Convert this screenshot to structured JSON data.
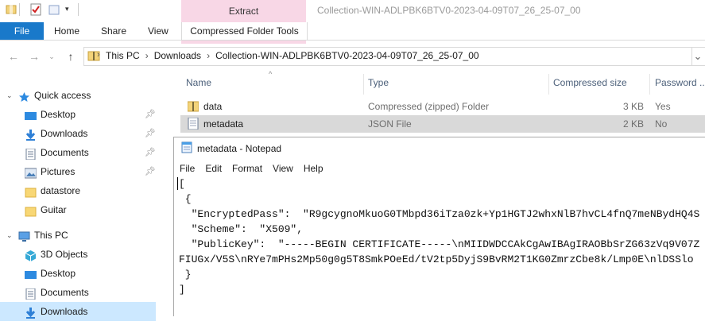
{
  "title_bar": {
    "window_title": "Collection-WIN-ADLPBK6BTV0-2023-04-09T07_26_25-07_00",
    "context_group": "Extract"
  },
  "ribbon": {
    "tabs": [
      {
        "label": "File"
      },
      {
        "label": "Home"
      },
      {
        "label": "Share"
      },
      {
        "label": "View"
      },
      {
        "label": "Compressed Folder Tools"
      }
    ]
  },
  "address": {
    "crumbs": [
      "This PC",
      "Downloads",
      "Collection-WIN-ADLPBK6BTV0-2023-04-09T07_26_25-07_00"
    ]
  },
  "sidebar": {
    "items": [
      {
        "label": "Quick access",
        "icon": "star-icon",
        "pinned": false
      },
      {
        "label": "Desktop",
        "icon": "desktop-icon",
        "pinned": true
      },
      {
        "label": "Downloads",
        "icon": "download-icon",
        "pinned": true
      },
      {
        "label": "Documents",
        "icon": "documents-icon",
        "pinned": true
      },
      {
        "label": "Pictures",
        "icon": "pictures-icon",
        "pinned": true
      },
      {
        "label": "datastore",
        "icon": "folder-icon",
        "pinned": false
      },
      {
        "label": "Guitar",
        "icon": "folder-icon",
        "pinned": false
      },
      {
        "label": "This PC",
        "icon": "computer-icon",
        "pinned": false
      },
      {
        "label": "3D Objects",
        "icon": "cube-icon",
        "pinned": false
      },
      {
        "label": "Desktop",
        "icon": "desktop-icon",
        "pinned": false
      },
      {
        "label": "Documents",
        "icon": "documents-icon",
        "pinned": false
      },
      {
        "label": "Downloads",
        "icon": "download-icon",
        "pinned": false
      }
    ]
  },
  "file_list": {
    "columns": [
      "Name",
      "Type",
      "Compressed size",
      "Password ..."
    ],
    "rows": [
      {
        "name": "data",
        "type": "Compressed (zipped) Folder",
        "size": "3 KB",
        "password": "Yes",
        "icon": "folder-icon"
      },
      {
        "name": "metadata",
        "type": "JSON File",
        "size": "2 KB",
        "password": "No",
        "icon": "json-file-icon"
      }
    ]
  },
  "notepad": {
    "title": "metadata - Notepad",
    "menu": [
      "File",
      "Edit",
      "Format",
      "View",
      "Help"
    ],
    "content": "[\n {\n  \"EncryptedPass\":  \"R9gcygnoMkuoG0TMbpd36iTza0zk+Yp1HGTJ2whxNlB7hvCL4fnQ7meNBydHQ4S\n  \"Scheme\":  \"X509\",\n  \"PublicKey\":  \"-----BEGIN CERTIFICATE-----\\nMIIDWDCCAkCgAwIBAgIRAOBbSrZG63zVq9V07Z\nFIUGx/V5S\\nRYe7mPHs2Mp50g0g5T8SmkPOeEd/tV2tp5DyjS9BvRM2T1KG0ZmrzCbe8k/Lmp0E\\nlDSSlo\n }\n]"
  },
  "colors": {
    "file_tab": "#1979ca",
    "extract_context": "#f8d7e6",
    "selection": "#d9d9d9",
    "sidebar_selection": "#cce8ff"
  }
}
